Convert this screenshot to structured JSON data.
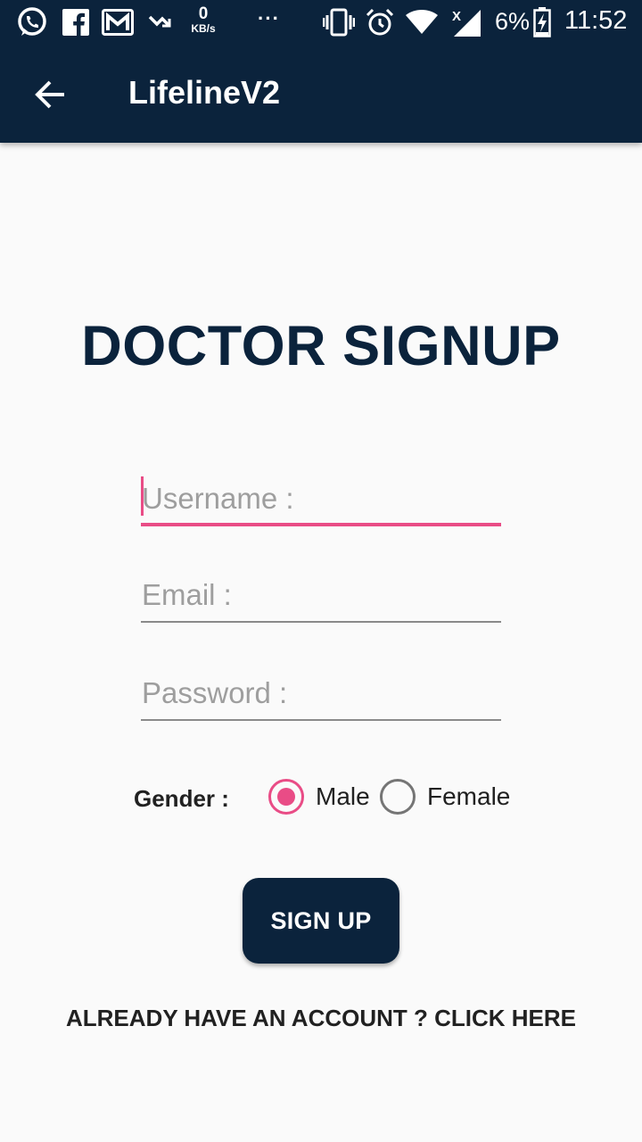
{
  "status_bar": {
    "icons": [
      "whatsapp-icon",
      "facebook-icon",
      "gmail-icon",
      "missed-call-icon"
    ],
    "net_speed_value": "0",
    "net_speed_unit": "KB/s",
    "more_indicator": "···",
    "right_icons": [
      "vibrate-icon",
      "alarm-icon",
      "wifi-icon",
      "signal-icon"
    ],
    "battery_percent": "6%",
    "time": "11:52"
  },
  "app_bar": {
    "title": "LifelineV2",
    "back_icon": "arrow-back-icon"
  },
  "form": {
    "heading": "DOCTOR SIGNUP",
    "username_placeholder": "Username :",
    "email_placeholder": "Email :",
    "password_placeholder": "Password :",
    "gender_label": "Gender :",
    "gender_options": [
      {
        "label": "Male",
        "checked": true
      },
      {
        "label": "Female",
        "checked": false
      }
    ],
    "submit_label": "SIGN UP",
    "login_link": "ALREADY HAVE AN ACCOUNT ? CLICK HERE"
  },
  "colors": {
    "primary": "#0b233c",
    "accent": "#e94c86",
    "background": "#fafafa"
  }
}
